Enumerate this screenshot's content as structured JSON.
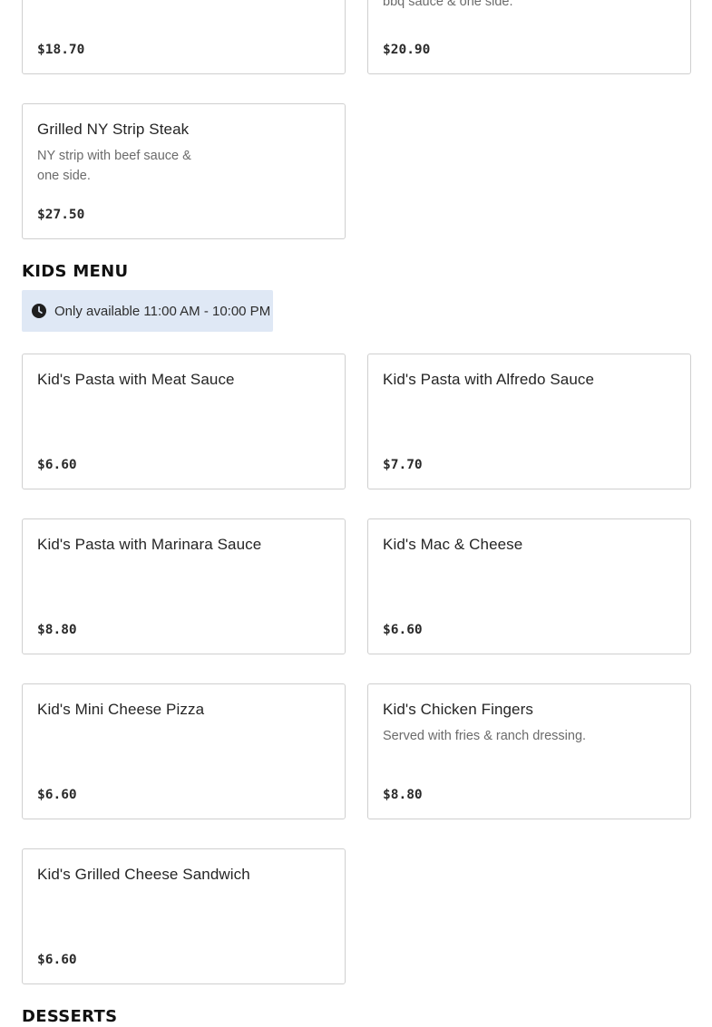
{
  "top_items": [
    {
      "name": "",
      "description": "",
      "price": "$18.70"
    },
    {
      "name": "",
      "description": "bbq sauce & one side.",
      "price": "$20.90"
    },
    {
      "name": "Grilled NY Strip Steak",
      "description": "NY strip with beef sauce & one side.",
      "price": "$27.50"
    }
  ],
  "kids_menu": {
    "title": "KIDS MENU",
    "availability_icon": "clock-icon",
    "availability": "Only available 11:00 AM - 10:00 PM",
    "items": [
      {
        "name": "Kid's Pasta with Meat Sauce",
        "description": "",
        "price": "$6.60"
      },
      {
        "name": "Kid's Pasta with Alfredo Sauce",
        "description": "",
        "price": "$7.70"
      },
      {
        "name": "Kid's Pasta with Marinara Sauce",
        "description": "",
        "price": "$8.80"
      },
      {
        "name": "Kid's Mac & Cheese",
        "description": "",
        "price": "$6.60"
      },
      {
        "name": "Kid's Mini Cheese Pizza",
        "description": "",
        "price": "$6.60"
      },
      {
        "name": "Kid's Chicken Fingers",
        "description": "Served with fries & ranch dressing.",
        "price": "$8.80"
      },
      {
        "name": "Kid's Grilled Cheese Sandwich",
        "description": "",
        "price": "$6.60"
      }
    ]
  },
  "desserts": {
    "title": "DESSERTS"
  }
}
